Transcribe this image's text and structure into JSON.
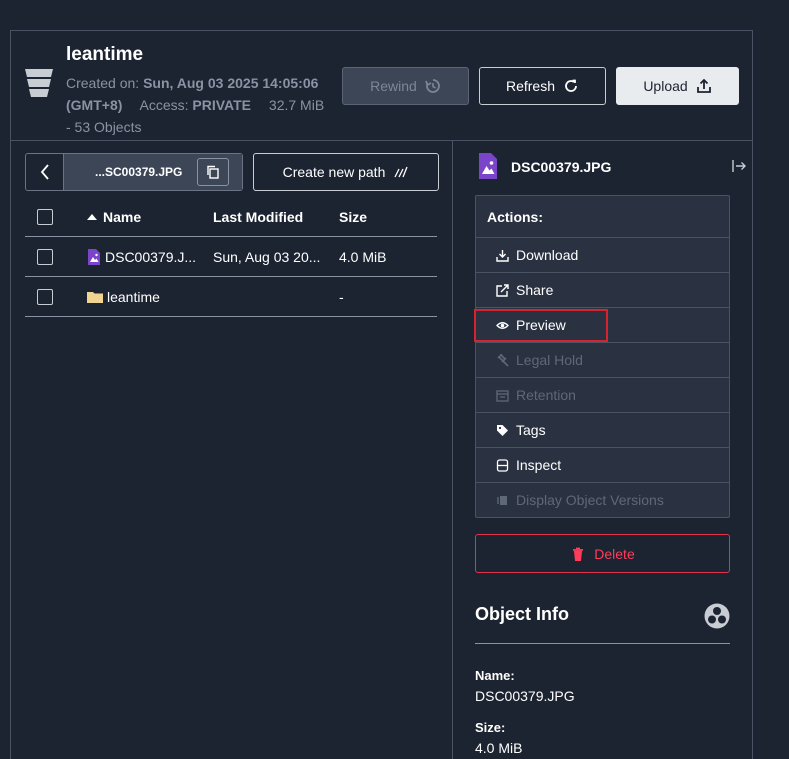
{
  "bucket": {
    "name": "leantime",
    "created_label": "Created on:",
    "created_value": "Sun, Aug 03 2025 14:05:06",
    "timezone": "(GMT+8)",
    "access_label": "Access:",
    "access_value": "PRIVATE",
    "size": "32.7 MiB",
    "objects": "- 53 Objects"
  },
  "toolbar": {
    "rewind_label": "Rewind",
    "refresh_label": "Refresh",
    "upload_label": "Upload"
  },
  "path": {
    "current": "...SC00379.JPG",
    "create_new_label": "Create new path"
  },
  "table": {
    "headers": {
      "name": "Name",
      "modified": "Last Modified",
      "size": "Size"
    },
    "rows": [
      {
        "name": "DSC00379.J...",
        "modified": "Sun, Aug 03 20...",
        "size": "4.0 MiB",
        "type": "image-file"
      },
      {
        "name": "leantime",
        "modified": "",
        "size": "-",
        "type": "folder"
      }
    ]
  },
  "details": {
    "filename": "DSC00379.JPG",
    "actions_title": "Actions:",
    "actions": [
      {
        "label": "Download",
        "icon": "download-icon",
        "enabled": true
      },
      {
        "label": "Share",
        "icon": "share-icon",
        "enabled": true
      },
      {
        "label": "Preview",
        "icon": "eye-icon",
        "enabled": true
      },
      {
        "label": "Legal Hold",
        "icon": "gavel-icon",
        "enabled": false
      },
      {
        "label": "Retention",
        "icon": "retention-icon",
        "enabled": false
      },
      {
        "label": "Tags",
        "icon": "tag-icon",
        "enabled": true
      },
      {
        "label": "Inspect",
        "icon": "inspect-icon",
        "enabled": true
      },
      {
        "label": "Display Object Versions",
        "icon": "versions-icon",
        "enabled": false
      }
    ],
    "delete_label": "Delete",
    "object_info_title": "Object Info",
    "name_label": "Name:",
    "name_value": "DSC00379.JPG",
    "size_label": "Size:",
    "size_value": "4.0 MiB"
  },
  "colors": {
    "background": "#1c2331",
    "accent_purple": "#7b45c9",
    "danger": "#ff3d5a",
    "highlight": "#d6242f",
    "folder": "#f2d492"
  }
}
